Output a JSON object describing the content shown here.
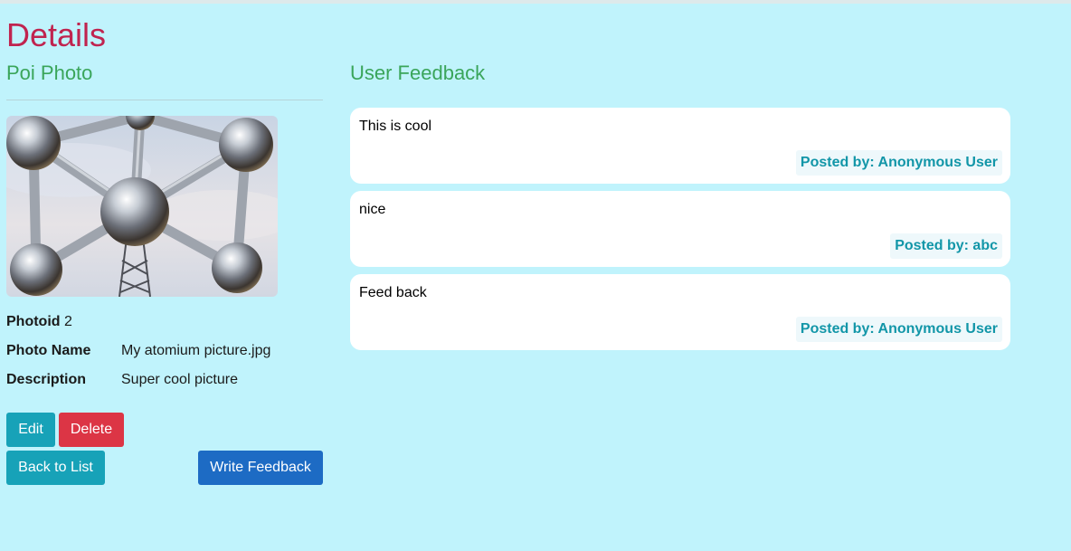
{
  "page": {
    "title": "Details"
  },
  "poi": {
    "heading": "Poi Photo",
    "fields": [
      {
        "label": "Photoid",
        "value": "2"
      },
      {
        "label": "Photo Name",
        "value": "My atomium picture.jpg"
      },
      {
        "label": "Description",
        "value": "Super cool picture"
      }
    ],
    "actions": {
      "edit": "Edit",
      "delete": "Delete",
      "back": "Back to List",
      "write_feedback": "Write Feedback"
    }
  },
  "feedback": {
    "heading": "User Feedback",
    "items": [
      {
        "text": "This is cool",
        "author": "Posted by: Anonymous User"
      },
      {
        "text": "nice",
        "author": "Posted by: abc"
      },
      {
        "text": "Feed back",
        "author": "Posted by: Anonymous User"
      }
    ]
  },
  "colors": {
    "background": "#c0f3fc",
    "title": "#c0244f",
    "section_heading": "#3aa55a",
    "info_button": "#17a2b8",
    "danger_button": "#dc3545",
    "primary_button": "#1d6bc4",
    "author_text": "#1296a8"
  }
}
